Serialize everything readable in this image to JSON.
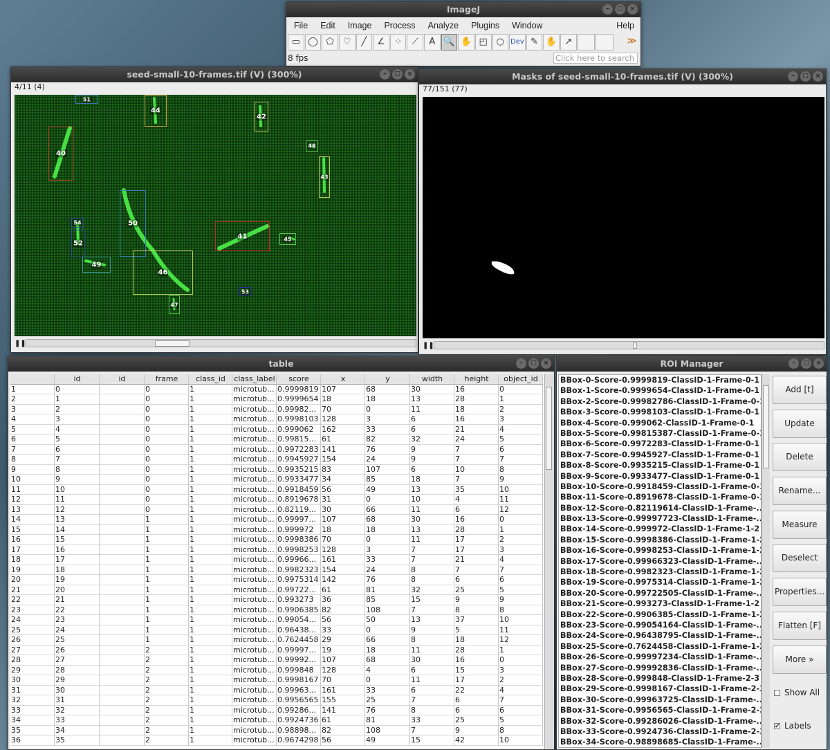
{
  "imagej": {
    "title": "ImageJ",
    "menus": [
      "File",
      "Edit",
      "Image",
      "Process",
      "Analyze",
      "Plugins",
      "Window"
    ],
    "help": "Help",
    "tools": [
      "rectangle-tool",
      "oval-tool",
      "polygon-tool",
      "freehand-tool",
      "line-tool",
      "angle-tool",
      "multipoint-tool",
      "wand-tool",
      "text-tool",
      "magnifier-tool",
      "hand-tool",
      "color-picker-tool",
      "zoom-tool",
      "dev-tool",
      "pencil-tool",
      "brush-tool",
      "arrow-tool",
      "blank-tool",
      "blank-tool",
      "more-tools"
    ],
    "tool_glyphs": [
      "▭",
      "◯",
      "⬠",
      "♡",
      "╱",
      "∠",
      "⁘",
      "⟋",
      "A",
      "🔍",
      "✋",
      "◰",
      "○",
      "Dev",
      "✎",
      "✋",
      "↗",
      "",
      "",
      "≫"
    ],
    "status": "8 fps",
    "search_placeholder": "Click here to search"
  },
  "image_window": {
    "title": "seed-small-10-frames.tif (V) (300%)",
    "info": "4/11 (4)",
    "slice_pos": 0.33
  },
  "mask_window": {
    "title": "Masks of seed-small-10-frames.tif (V) (300%)",
    "info": "77/151 (77)",
    "slice_pos": 0.51
  },
  "boxes": [
    {
      "id": "51",
      "color": "#3a6fb0"
    },
    {
      "id": "44",
      "color": "#c9a040"
    },
    {
      "id": "42",
      "color": "#b8c860"
    },
    {
      "id": "40",
      "color": "#c0402a"
    },
    {
      "id": "48",
      "color": "#58c050"
    },
    {
      "id": "43",
      "color": "#b8c860"
    },
    {
      "id": "50",
      "color": "#3a7fb0"
    },
    {
      "id": "54",
      "color": "#2a4a9a"
    },
    {
      "id": "52",
      "color": "#2a4a9a"
    },
    {
      "id": "41",
      "color": "#c02a2a"
    },
    {
      "id": "45",
      "color": "#58c050"
    },
    {
      "id": "49",
      "color": "#3a9a9a"
    },
    {
      "id": "46",
      "color": "#b8c860"
    },
    {
      "id": "47",
      "color": "#58c050"
    },
    {
      "id": "53",
      "color": "#2a2a9a"
    }
  ],
  "table": {
    "title": "table",
    "columns": [
      "",
      "id",
      "id",
      "frame",
      "class_id",
      "class_label",
      "score",
      "x",
      "y",
      "width",
      "height",
      "object_id"
    ],
    "rows": [
      [
        "1",
        "0",
        "",
        "0",
        "1",
        "microtub...",
        "0.9999819",
        "107",
        "68",
        "30",
        "16",
        "0"
      ],
      [
        "2",
        "1",
        "",
        "0",
        "1",
        "microtub...",
        "0.9999654",
        "18",
        "18",
        "13",
        "28",
        "1"
      ],
      [
        "3",
        "2",
        "",
        "0",
        "1",
        "microtub...",
        "0.99982...",
        "70",
        "0",
        "11",
        "18",
        "2"
      ],
      [
        "4",
        "3",
        "",
        "0",
        "1",
        "microtub...",
        "0.9998103",
        "128",
        "3",
        "6",
        "16",
        "3"
      ],
      [
        "5",
        "4",
        "",
        "0",
        "1",
        "microtub...",
        "0.999062",
        "162",
        "33",
        "6",
        "21",
        "4"
      ],
      [
        "6",
        "5",
        "",
        "0",
        "1",
        "microtub...",
        "0.99815...",
        "61",
        "82",
        "32",
        "24",
        "5"
      ],
      [
        "7",
        "6",
        "",
        "0",
        "1",
        "microtub...",
        "0.9972283",
        "141",
        "76",
        "9",
        "7",
        "6"
      ],
      [
        "8",
        "7",
        "",
        "0",
        "1",
        "microtub...",
        "0.9945927",
        "154",
        "24",
        "9",
        "7",
        "7"
      ],
      [
        "9",
        "8",
        "",
        "0",
        "1",
        "microtub...",
        "0.9935215",
        "83",
        "107",
        "6",
        "10",
        "8"
      ],
      [
        "10",
        "9",
        "",
        "0",
        "1",
        "microtub...",
        "0.9933477",
        "34",
        "85",
        "18",
        "7",
        "9"
      ],
      [
        "11",
        "10",
        "",
        "0",
        "1",
        "microtub...",
        "0.9918459",
        "56",
        "49",
        "13",
        "35",
        "10"
      ],
      [
        "12",
        "11",
        "",
        "0",
        "1",
        "microtub...",
        "0.8919678",
        "31",
        "0",
        "10",
        "4",
        "11"
      ],
      [
        "13",
        "12",
        "",
        "0",
        "1",
        "microtub...",
        "0.82119...",
        "30",
        "66",
        "11",
        "6",
        "12"
      ],
      [
        "14",
        "13",
        "",
        "1",
        "1",
        "microtub...",
        "0.99997...",
        "107",
        "68",
        "30",
        "16",
        "0"
      ],
      [
        "15",
        "14",
        "",
        "1",
        "1",
        "microtub...",
        "0.999972",
        "18",
        "18",
        "13",
        "28",
        "1"
      ],
      [
        "16",
        "15",
        "",
        "1",
        "1",
        "microtub...",
        "0.9998386",
        "70",
        "0",
        "11",
        "17",
        "2"
      ],
      [
        "17",
        "16",
        "",
        "1",
        "1",
        "microtub...",
        "0.9998253",
        "128",
        "3",
        "7",
        "17",
        "3"
      ],
      [
        "18",
        "17",
        "",
        "1",
        "1",
        "microtub...",
        "0.99966...",
        "161",
        "33",
        "7",
        "21",
        "4"
      ],
      [
        "19",
        "18",
        "",
        "1",
        "1",
        "microtub...",
        "0.9982323",
        "154",
        "24",
        "8",
        "7",
        "7"
      ],
      [
        "20",
        "19",
        "",
        "1",
        "1",
        "microtub...",
        "0.9975314",
        "142",
        "76",
        "8",
        "6",
        "6"
      ],
      [
        "21",
        "20",
        "",
        "1",
        "1",
        "microtub...",
        "0.99722...",
        "61",
        "81",
        "32",
        "25",
        "5"
      ],
      [
        "22",
        "21",
        "",
        "1",
        "1",
        "microtub...",
        "0.993273",
        "36",
        "85",
        "15",
        "9",
        "9"
      ],
      [
        "23",
        "22",
        "",
        "1",
        "1",
        "microtub...",
        "0.9906385",
        "82",
        "108",
        "7",
        "8",
        "8"
      ],
      [
        "24",
        "23",
        "",
        "1",
        "1",
        "microtub...",
        "0.99054...",
        "56",
        "50",
        "13",
        "37",
        "10"
      ],
      [
        "25",
        "24",
        "",
        "1",
        "1",
        "microtub...",
        "0.96438...",
        "33",
        "0",
        "9",
        "5",
        "11"
      ],
      [
        "26",
        "25",
        "",
        "1",
        "1",
        "microtub...",
        "0.7624458",
        "29",
        "66",
        "8",
        "18",
        "12"
      ],
      [
        "27",
        "26",
        "",
        "2",
        "1",
        "microtub...",
        "0.99997...",
        "19",
        "18",
        "11",
        "28",
        "1"
      ],
      [
        "28",
        "27",
        "",
        "2",
        "1",
        "microtub...",
        "0.99992...",
        "107",
        "68",
        "30",
        "16",
        "0"
      ],
      [
        "29",
        "28",
        "",
        "2",
        "1",
        "microtub...",
        "0.999848",
        "128",
        "4",
        "6",
        "15",
        "3"
      ],
      [
        "30",
        "29",
        "",
        "2",
        "1",
        "microtub...",
        "0.9998167",
        "70",
        "0",
        "11",
        "17",
        "2"
      ],
      [
        "31",
        "30",
        "",
        "2",
        "1",
        "microtub...",
        "0.99963...",
        "161",
        "33",
        "6",
        "22",
        "4"
      ],
      [
        "32",
        "31",
        "",
        "2",
        "1",
        "microtub...",
        "0.9956565",
        "155",
        "25",
        "7",
        "6",
        "7"
      ],
      [
        "33",
        "32",
        "",
        "2",
        "1",
        "microtub...",
        "0.99286...",
        "141",
        "76",
        "8",
        "6",
        "6"
      ],
      [
        "34",
        "33",
        "",
        "2",
        "1",
        "microtub...",
        "0.9924736",
        "61",
        "81",
        "33",
        "25",
        "5"
      ],
      [
        "35",
        "34",
        "",
        "2",
        "1",
        "microtub...",
        "0.98898...",
        "82",
        "108",
        "7",
        "9",
        "8"
      ],
      [
        "36",
        "35",
        "",
        "2",
        "1",
        "microtub...",
        "0.9674298",
        "56",
        "49",
        "15",
        "42",
        "10"
      ]
    ]
  },
  "roi_manager": {
    "title": "ROI Manager",
    "items": [
      "BBox-0-Score-0.9999819-ClassID-1-Frame-0-1",
      "BBox-1-Score-0.9999654-ClassID-1-Frame-0-1",
      "BBox-2-Score-0.99982786-ClassID-1-Frame-0-1",
      "BBox-3-Score-0.9998103-ClassID-1-Frame-0-1",
      "BBox-4-Score-0.999062-ClassID-1-Frame-0-1",
      "BBox-5-Score-0.99815387-ClassID-1-Frame-0-1",
      "BBox-6-Score-0.9972283-ClassID-1-Frame-0-1",
      "BBox-7-Score-0.9945927-ClassID-1-Frame-0-1",
      "BBox-8-Score-0.9935215-ClassID-1-Frame-0-1",
      "BBox-9-Score-0.9933477-ClassID-1-Frame-0-1",
      "BBox-10-Score-0.9918459-ClassID-1-Frame-0-1",
      "BBox-11-Score-0.8919678-ClassID-1-Frame-0-1",
      "BBox-12-Score-0.82119614-ClassID-1-Frame-...",
      "BBox-13-Score-0.99997723-ClassID-1-Frame-...",
      "BBox-14-Score-0.999972-ClassID-1-Frame-1-2",
      "BBox-15-Score-0.9998386-ClassID-1-Frame-1-2",
      "BBox-16-Score-0.9998253-ClassID-1-Frame-1-2",
      "BBox-17-Score-0.99966323-ClassID-1-Frame-...",
      "BBox-18-Score-0.9982323-ClassID-1-Frame-1-2",
      "BBox-19-Score-0.9975314-ClassID-1-Frame-1-2",
      "BBox-20-Score-0.99722505-ClassID-1-Frame-...",
      "BBox-21-Score-0.993273-ClassID-1-Frame-1-2",
      "BBox-22-Score-0.9906385-ClassID-1-Frame-1-2",
      "BBox-23-Score-0.99054164-ClassID-1-Frame-...",
      "BBox-24-Score-0.96438795-ClassID-1-Frame-...",
      "BBox-25-Score-0.7624458-ClassID-1-Frame-1-2",
      "BBox-26-Score-0.99997234-ClassID-1-Frame-...",
      "BBox-27-Score-0.99992836-ClassID-1-Frame-...",
      "BBox-28-Score-0.999848-ClassID-1-Frame-2-3",
      "BBox-29-Score-0.9998167-ClassID-1-Frame-2-3",
      "BBox-30-Score-0.99963725-ClassID-1-Frame-...",
      "BBox-31-Score-0.9956565-ClassID-1-Frame-2-3",
      "BBox-32-Score-0.99286026-ClassID-1-Frame-...",
      "BBox-33-Score-0.9924736-ClassID-1-Frame-2-3",
      "BBox-34-Score-0.98898685-ClassID-1-Frame-..."
    ],
    "buttons": [
      "Add [t]",
      "Update",
      "Delete",
      "Rename...",
      "Measure",
      "Deselect",
      "Properties...",
      "Flatten [F]",
      "More »"
    ],
    "show_all": "Show All",
    "labels": "Labels",
    "show_all_checked": false,
    "labels_checked": true
  }
}
